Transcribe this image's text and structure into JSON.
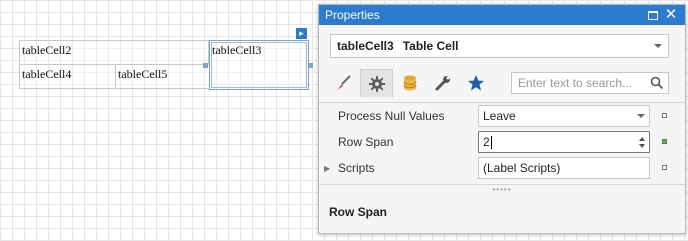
{
  "designer": {
    "cells": {
      "cell2": "tableCell2",
      "cell3": "tableCell3",
      "cell4": "tableCell4",
      "cell5": "tableCell5"
    }
  },
  "panel": {
    "title": "Properties",
    "object": {
      "name": "tableCell3",
      "type": "Table Cell"
    },
    "tabs": [
      {
        "icon": "brush-icon",
        "active": false
      },
      {
        "icon": "gear-icon",
        "active": true
      },
      {
        "icon": "database-icon",
        "active": false
      },
      {
        "icon": "wrench-icon",
        "active": false
      },
      {
        "icon": "star-icon",
        "active": false
      }
    ],
    "search": {
      "placeholder": "Enter text to search..."
    },
    "properties": [
      {
        "label": "Process Null Values",
        "value": "Leave"
      },
      {
        "label": "Row Span",
        "value": "2"
      },
      {
        "label": "Scripts",
        "value": "(Label Scripts)"
      }
    ],
    "description": {
      "title": "Row Span"
    }
  },
  "colors": {
    "accent": "#2b7cd0",
    "modified_marker": "#5fae5a",
    "favorite_star": "#1f5fa8"
  }
}
